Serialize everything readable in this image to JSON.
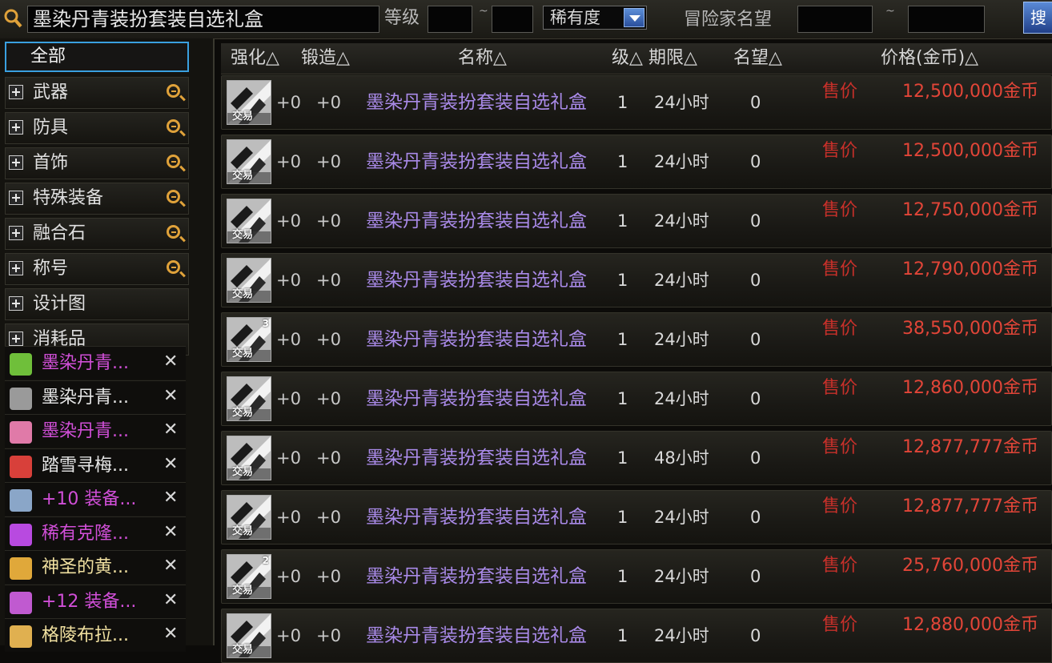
{
  "search": {
    "query": "墨染丹青装扮套装自选礼盒",
    "level_label": "等级",
    "range_sep": "~",
    "rarity_label": "稀有度",
    "fame_label": "冒险家名望",
    "search_btn": "搜"
  },
  "sidebar": {
    "all_label": "全部",
    "categories": [
      {
        "label": "武器",
        "zoom": true
      },
      {
        "label": "防具",
        "zoom": true
      },
      {
        "label": "首饰",
        "zoom": true
      },
      {
        "label": "特殊装备",
        "zoom": true
      },
      {
        "label": "融合石",
        "zoom": true
      },
      {
        "label": "称号",
        "zoom": true
      },
      {
        "label": "设计图",
        "zoom": false
      },
      {
        "label": "消耗品",
        "zoom": false
      }
    ],
    "history": [
      {
        "text": "墨染丹青...",
        "color": "#d14fd8",
        "icon_color": "#6fbf3a"
      },
      {
        "text": "墨染丹青...",
        "color": "#e6e6e6",
        "icon_color": "#9a9a9a"
      },
      {
        "text": "墨染丹青...",
        "color": "#d14fd8",
        "icon_color": "#e07aa8"
      },
      {
        "text": "踏雪寻梅...",
        "color": "#e6e6e6",
        "icon_color": "#d8403a"
      },
      {
        "text": "+10 装备...",
        "color": "#d14fd8",
        "icon_color": "#8aa6c8"
      },
      {
        "text": "稀有克隆...",
        "color": "#d14fd8",
        "icon_color": "#b84ae0"
      },
      {
        "text": "神圣的黄...",
        "color": "#f0e0a0",
        "icon_color": "#e0a83a"
      },
      {
        "text": "+12 装备...",
        "color": "#d14fd8",
        "icon_color": "#c05ad0"
      },
      {
        "text": "格陵布拉...",
        "color": "#f0e0a0",
        "icon_color": "#e0b050"
      }
    ],
    "close_glyph": "✕"
  },
  "table": {
    "headers": {
      "enhance": "强化△",
      "forge": "锻造△",
      "name": "名称△",
      "level": "级△",
      "period": "期限△",
      "fame": "名望△",
      "price": "价格(金币)△"
    },
    "trade_tag": "交易",
    "rows": [
      {
        "stack": "",
        "enhance": "+0",
        "forge": "+0",
        "name": "墨染丹青装扮套装自选礼盒",
        "level": "1",
        "period": "24小时",
        "fame": "0",
        "sale_label": "售价",
        "price": "12,500,000金币"
      },
      {
        "stack": "",
        "enhance": "+0",
        "forge": "+0",
        "name": "墨染丹青装扮套装自选礼盒",
        "level": "1",
        "period": "24小时",
        "fame": "0",
        "sale_label": "售价",
        "price": "12,500,000金币"
      },
      {
        "stack": "",
        "enhance": "+0",
        "forge": "+0",
        "name": "墨染丹青装扮套装自选礼盒",
        "level": "1",
        "period": "24小时",
        "fame": "0",
        "sale_label": "售价",
        "price": "12,750,000金币"
      },
      {
        "stack": "",
        "enhance": "+0",
        "forge": "+0",
        "name": "墨染丹青装扮套装自选礼盒",
        "level": "1",
        "period": "24小时",
        "fame": "0",
        "sale_label": "售价",
        "price": "12,790,000金币"
      },
      {
        "stack": "3",
        "enhance": "+0",
        "forge": "+0",
        "name": "墨染丹青装扮套装自选礼盒",
        "level": "1",
        "period": "24小时",
        "fame": "0",
        "sale_label": "售价",
        "price": "38,550,000金币"
      },
      {
        "stack": "",
        "enhance": "+0",
        "forge": "+0",
        "name": "墨染丹青装扮套装自选礼盒",
        "level": "1",
        "period": "24小时",
        "fame": "0",
        "sale_label": "售价",
        "price": "12,860,000金币"
      },
      {
        "stack": "",
        "enhance": "+0",
        "forge": "+0",
        "name": "墨染丹青装扮套装自选礼盒",
        "level": "1",
        "period": "48小时",
        "fame": "0",
        "sale_label": "售价",
        "price": "12,877,777金币"
      },
      {
        "stack": "",
        "enhance": "+0",
        "forge": "+0",
        "name": "墨染丹青装扮套装自选礼盒",
        "level": "1",
        "period": "24小时",
        "fame": "0",
        "sale_label": "售价",
        "price": "12,877,777金币"
      },
      {
        "stack": "2",
        "enhance": "+0",
        "forge": "+0",
        "name": "墨染丹青装扮套装自选礼盒",
        "level": "1",
        "period": "24小时",
        "fame": "0",
        "sale_label": "售价",
        "price": "25,760,000金币"
      },
      {
        "stack": "",
        "enhance": "+0",
        "forge": "+0",
        "name": "墨染丹青装扮套装自选礼盒",
        "level": "1",
        "period": "24小时",
        "fame": "0",
        "sale_label": "售价",
        "price": "12,880,000金币"
      }
    ]
  }
}
